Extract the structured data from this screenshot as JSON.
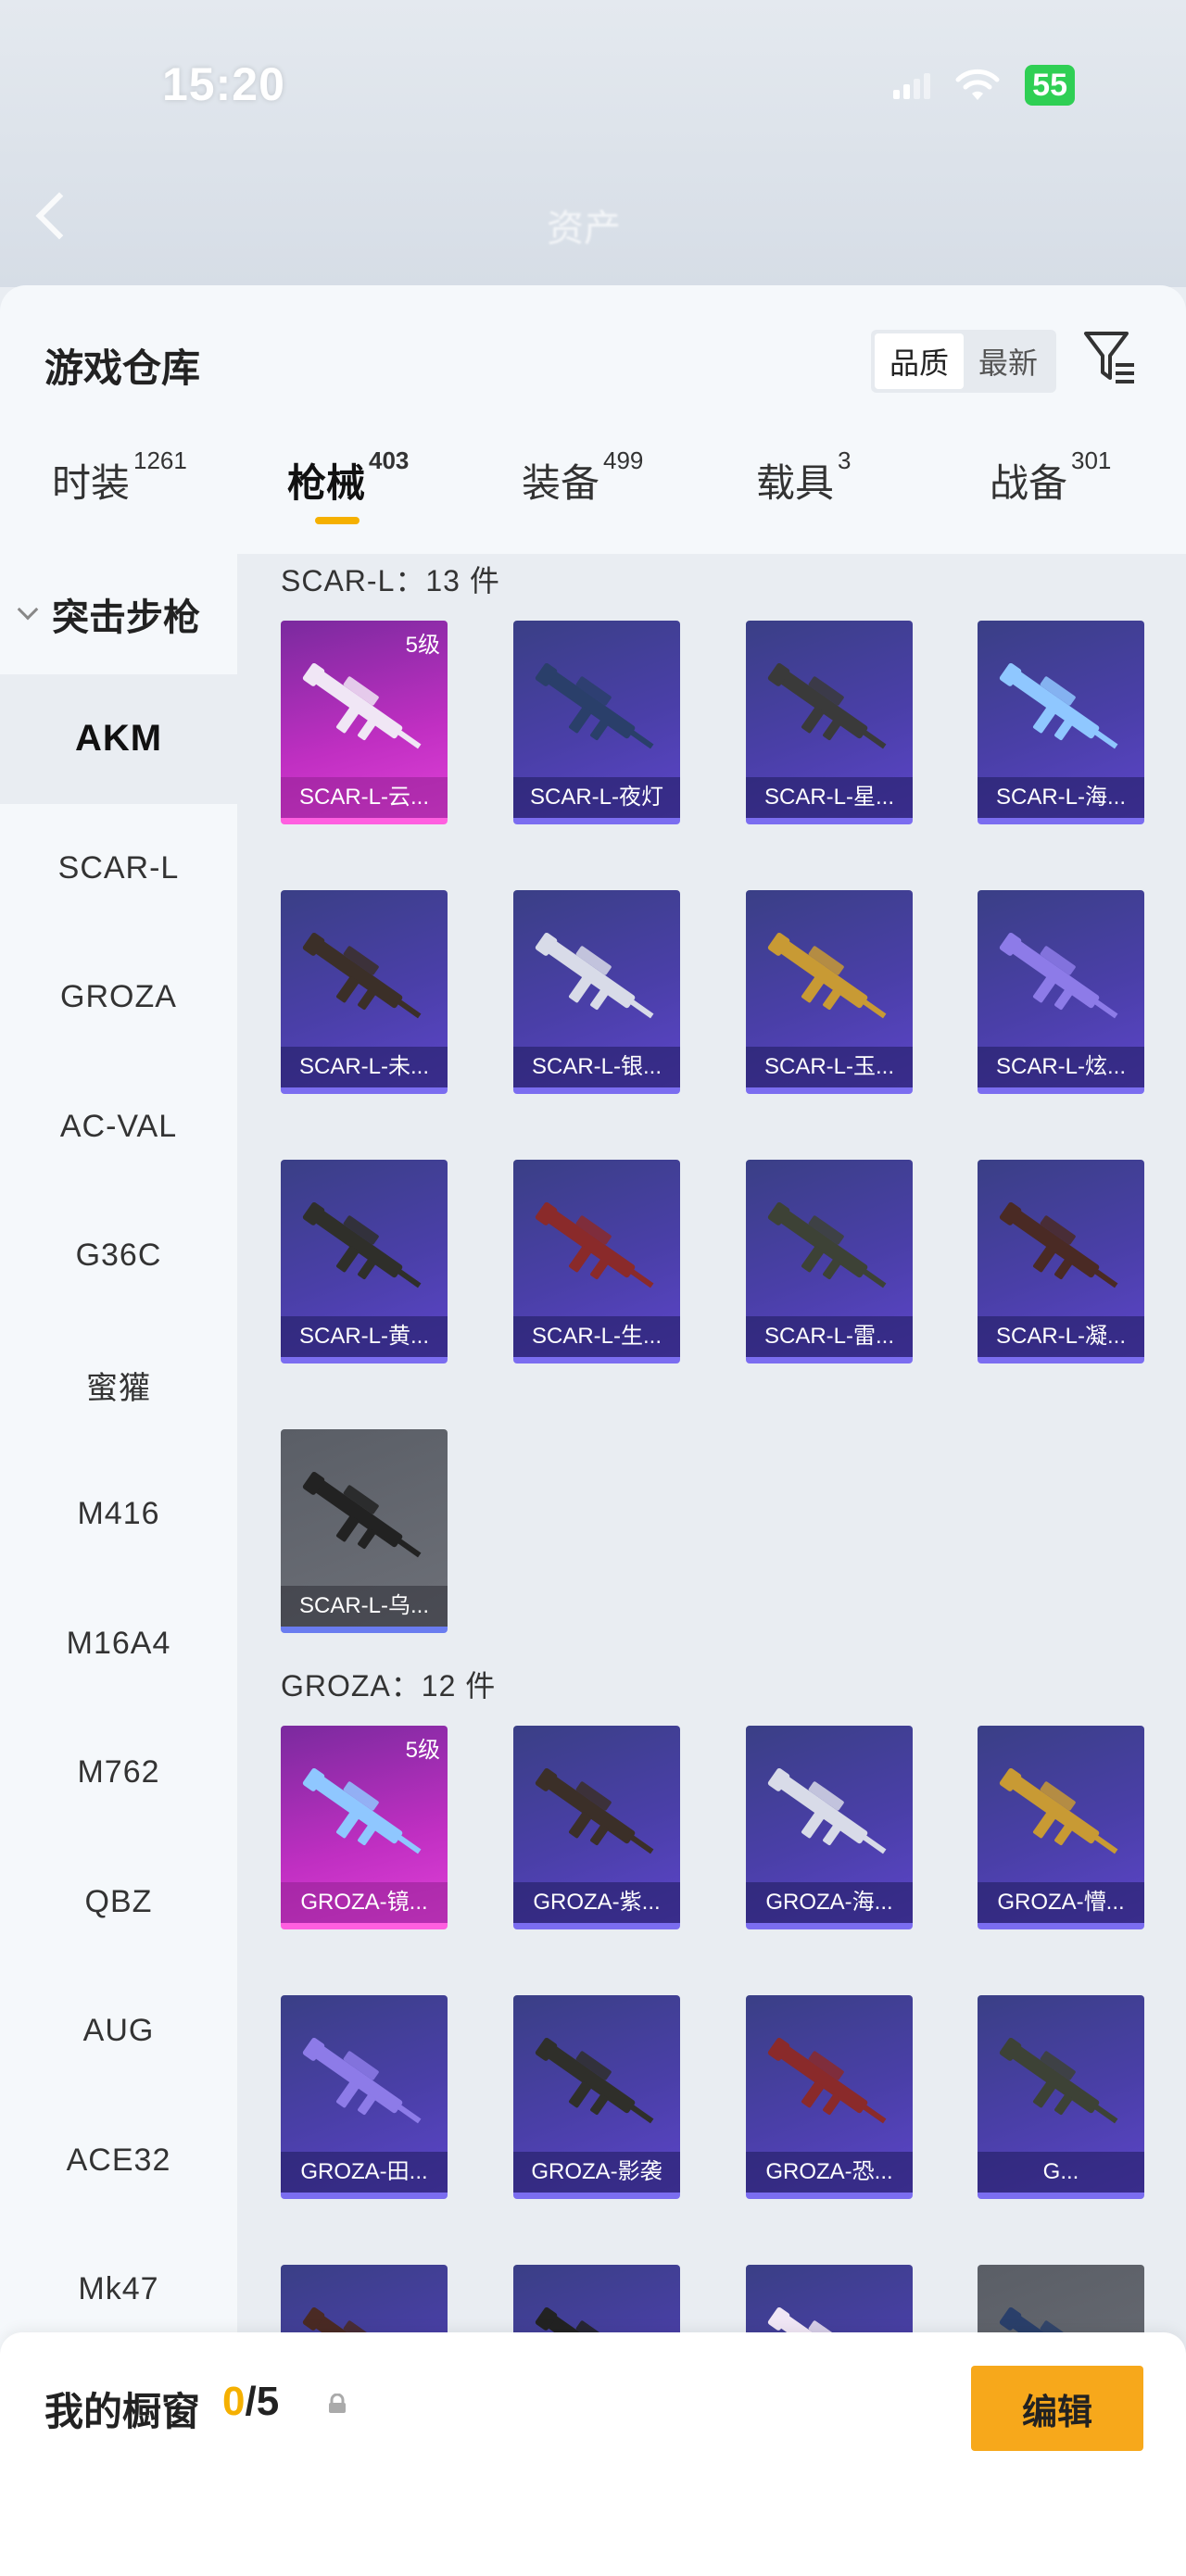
{
  "status_bar": {
    "time": "15:20",
    "battery": "55"
  },
  "header_ghost": {
    "title": "资产"
  },
  "panel": {
    "title": "游戏仓库",
    "sort_options": [
      "品质",
      "最新"
    ],
    "active_sort": "品质"
  },
  "tabs": [
    {
      "label": "时装",
      "count": "1261"
    },
    {
      "label": "枪械",
      "count": "403",
      "active": true
    },
    {
      "label": "装备",
      "count": "499"
    },
    {
      "label": "载具",
      "count": "3"
    },
    {
      "label": "战备",
      "count": "301"
    }
  ],
  "sidebar": {
    "group": "突击步枪",
    "items": [
      "AKM",
      "SCAR-L",
      "GROZA",
      "AC-VAL",
      "G36C",
      "蜜獾",
      "M416",
      "M16A4",
      "M762",
      "QBZ",
      "AUG",
      "ACE32",
      "Mk47"
    ],
    "active": "AKM"
  },
  "sections": [
    {
      "label": "SCAR-L：13 件",
      "items": [
        {
          "name": "SCAR-L-云...",
          "level": "5级",
          "tier": "gold"
        },
        {
          "name": "SCAR-L-夜灯",
          "tier": "purple"
        },
        {
          "name": "SCAR-L-星...",
          "tier": "purple"
        },
        {
          "name": "SCAR-L-海...",
          "tier": "purple"
        },
        {
          "name": "SCAR-L-未...",
          "tier": "purple"
        },
        {
          "name": "SCAR-L-银...",
          "tier": "purple"
        },
        {
          "name": "SCAR-L-玉...",
          "tier": "purple"
        },
        {
          "name": "SCAR-L-炫...",
          "tier": "purple"
        },
        {
          "name": "SCAR-L-黄...",
          "tier": "purple"
        },
        {
          "name": "SCAR-L-生...",
          "tier": "purple"
        },
        {
          "name": "SCAR-L-雷...",
          "tier": "purple"
        },
        {
          "name": "SCAR-L-凝...",
          "tier": "purple"
        },
        {
          "name": "SCAR-L-乌...",
          "tier": "grey"
        }
      ]
    },
    {
      "label": "GROZA：12 件",
      "items": [
        {
          "name": "GROZA-镜...",
          "level": "5级",
          "tier": "gold"
        },
        {
          "name": "GROZA-紫...",
          "tier": "purple"
        },
        {
          "name": "GROZA-海...",
          "tier": "purple"
        },
        {
          "name": "GROZA-懵...",
          "tier": "purple"
        },
        {
          "name": "GROZA-田...",
          "tier": "purple"
        },
        {
          "name": "GROZA-影袭",
          "tier": "purple"
        },
        {
          "name": "GROZA-恐...",
          "tier": "purple"
        },
        {
          "name": "G...",
          "tier": "purple"
        },
        {
          "name": "",
          "tier": "purple"
        },
        {
          "name": "",
          "tier": "purple"
        },
        {
          "name": "",
          "tier": "purple"
        },
        {
          "name": "",
          "tier": "grey"
        }
      ]
    }
  ],
  "showcase": {
    "label": "我的橱窗",
    "current": "0",
    "total": "/5",
    "edit_label": "编辑"
  },
  "colors": {
    "accent": "#f7a81b",
    "gold_card": "#c02fc2",
    "purple_card": "#4a3fa8",
    "grey_card": "#6d7078"
  }
}
